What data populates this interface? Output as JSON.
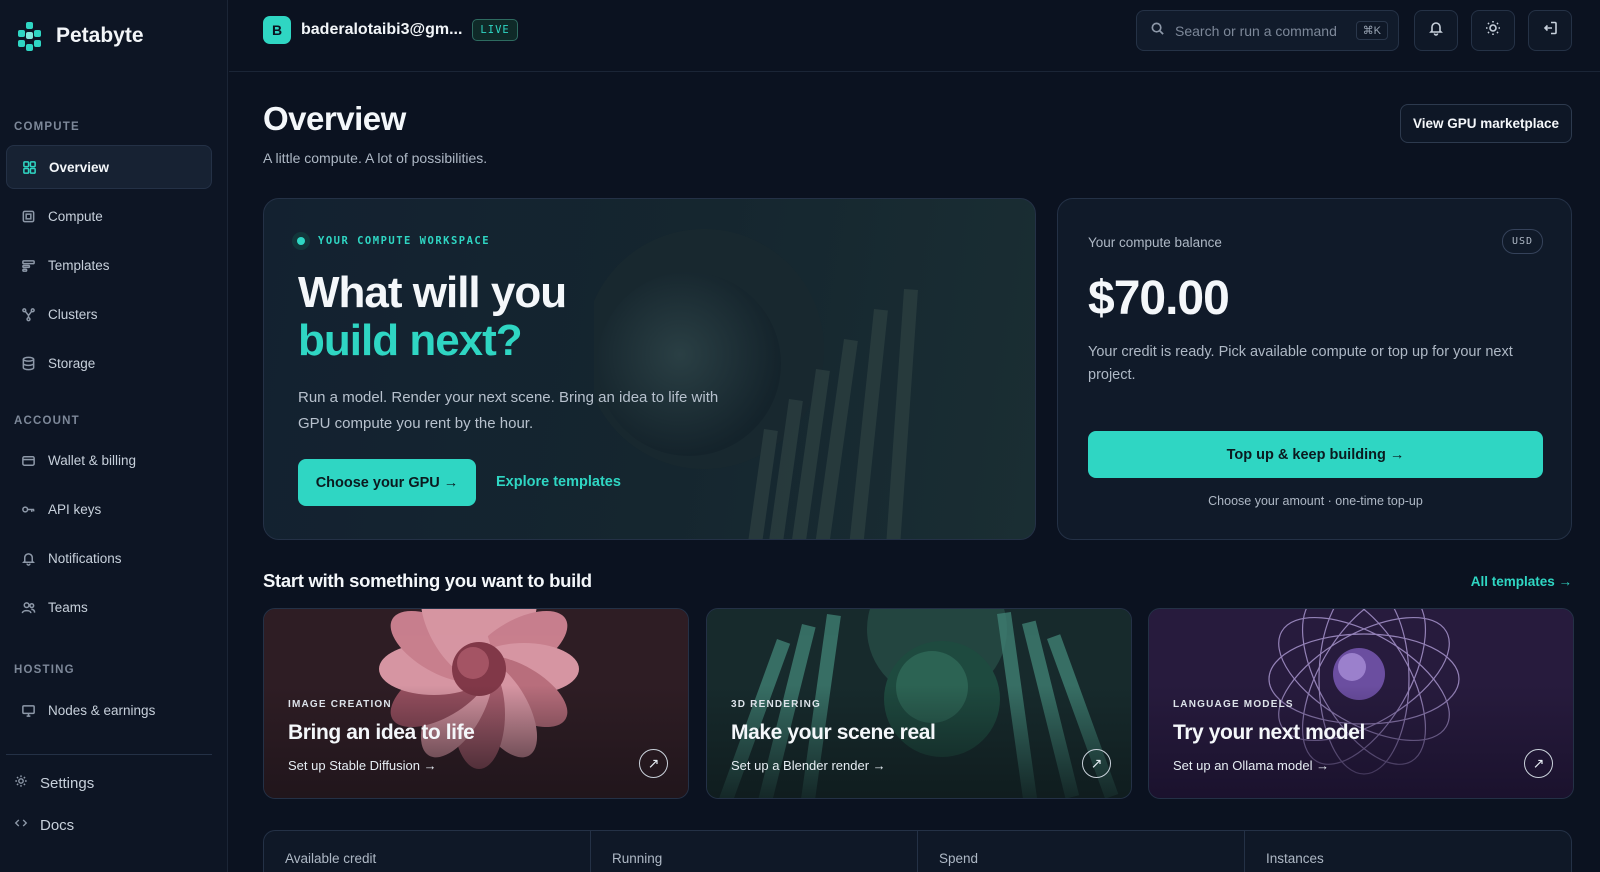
{
  "brand": {
    "name": "Petabyte"
  },
  "sidebar": {
    "sections": {
      "compute": "COMPUTE",
      "account": "ACCOUNT",
      "hosting": "HOSTING"
    },
    "items": [
      {
        "label": "Overview",
        "icon": "grid-icon",
        "active": true
      },
      {
        "label": "Compute",
        "icon": "chip-icon"
      },
      {
        "label": "Templates",
        "icon": "template-icon"
      },
      {
        "label": "Clusters",
        "icon": "cluster-icon"
      },
      {
        "label": "Storage",
        "icon": "database-icon"
      },
      {
        "label": "Wallet & billing",
        "icon": "wallet-icon"
      },
      {
        "label": "API keys",
        "icon": "key-icon"
      },
      {
        "label": "Notifications",
        "icon": "bell-icon"
      },
      {
        "label": "Teams",
        "icon": "users-icon"
      },
      {
        "label": "Nodes & earnings",
        "icon": "monitor-icon"
      }
    ],
    "footer": [
      {
        "label": "Settings",
        "icon": "gear-icon"
      },
      {
        "label": "Docs",
        "icon": "code-icon"
      }
    ]
  },
  "topbar": {
    "avatar_letter": "B",
    "email": "baderalotaibi3@gm...",
    "live_badge": "LIVE",
    "search_placeholder": "Search or run a command",
    "search_shortcut": "⌘K"
  },
  "header": {
    "title": "Overview",
    "subtitle": "A little compute. A lot of possibilities.",
    "marketplace_button": "View GPU marketplace"
  },
  "hero": {
    "eyebrow": "YOUR COMPUTE WORKSPACE",
    "heading_line1": "What will you",
    "heading_line2_plain": "build ",
    "heading_line2_accent": "next?",
    "body": "Run a model. Render your next scene. Bring an idea to life with GPU compute you rent by the hour.",
    "primary_button": "Choose your GPU →",
    "secondary_link": "Explore templates"
  },
  "balance": {
    "label": "Your compute balance",
    "currency": "USD",
    "amount": "$70.00",
    "description": "Your credit is ready. Pick available compute or top up for your next project.",
    "button": "Top up & keep building →",
    "note": "Choose your amount · one-time top-up"
  },
  "templates": {
    "title": "Start with something you want to build",
    "all_link": "All templates →",
    "cards": [
      {
        "tag": "IMAGE CREATION",
        "title": "Bring an idea to life",
        "link": "Set up Stable Diffusion →"
      },
      {
        "tag": "3D RENDERING",
        "title": "Make your scene real",
        "link": "Set up a Blender render →"
      },
      {
        "tag": "LANGUAGE MODELS",
        "title": "Try your next model",
        "link": "Set up an Ollama model →"
      }
    ]
  },
  "stats": [
    "Available credit",
    "Running",
    "Spend",
    "Instances"
  ],
  "colors": {
    "accent": "#2fd6c3",
    "background": "#0b1220"
  }
}
